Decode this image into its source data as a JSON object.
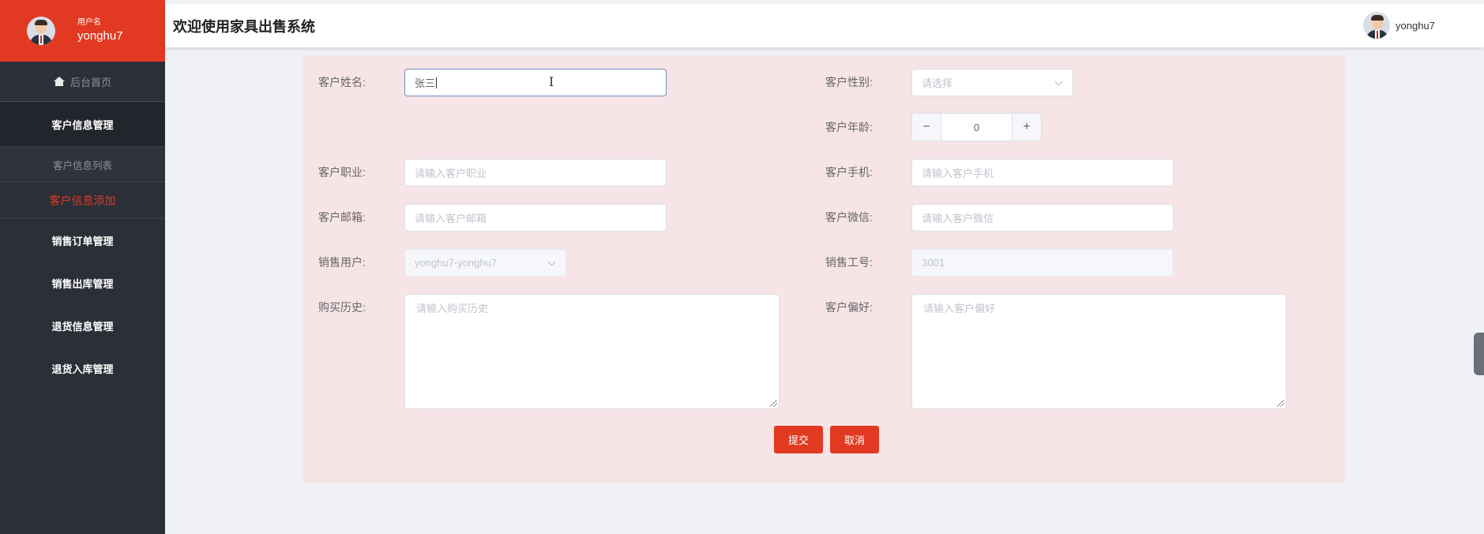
{
  "sidebar": {
    "user_label": "用户名",
    "username": "yonghu7",
    "items": [
      {
        "label": "后台首页"
      },
      {
        "label": "客户信息管理"
      },
      {
        "label": "客户信息列表"
      },
      {
        "label": "客户信息添加"
      },
      {
        "label": "销售订单管理"
      },
      {
        "label": "销售出库管理"
      },
      {
        "label": "退货信息管理"
      },
      {
        "label": "退货入库管理"
      }
    ]
  },
  "header": {
    "title": "欢迎使用家具出售系统",
    "username": "yonghu7"
  },
  "form": {
    "name": {
      "label": "客户姓名:",
      "value": "张三"
    },
    "gender": {
      "label": "客户性别:",
      "placeholder": "请选择"
    },
    "age": {
      "label": "客户年龄:",
      "value": "0",
      "minus": "−",
      "plus": "+"
    },
    "job": {
      "label": "客户职业:",
      "placeholder": "请输入客户职业"
    },
    "phone": {
      "label": "客户手机:",
      "placeholder": "请输入客户手机"
    },
    "email": {
      "label": "客户邮箱:",
      "placeholder": "请输入客户邮箱"
    },
    "wechat": {
      "label": "客户微信:",
      "placeholder": "请输入客户微信"
    },
    "sales_user": {
      "label": "销售用户:",
      "value": "yonghu7-yonghu7"
    },
    "sales_id": {
      "label": "销售工号:",
      "value": "3001"
    },
    "history": {
      "label": "购买历史:",
      "placeholder": "请输入购买历史"
    },
    "preference": {
      "label": "客户偏好:",
      "placeholder": "请输入客户偏好"
    },
    "submit_label": "提交",
    "cancel_label": "取消"
  },
  "colors": {
    "accent": "#e23a22",
    "sidebar_bg": "#2b2f37",
    "form_bg": "#f6e4e6"
  },
  "icons": {
    "home": "home-icon",
    "avatar": "avatar-icon",
    "select_arrow": "chevron-down-icon",
    "resize": "resize-grip-icon"
  }
}
